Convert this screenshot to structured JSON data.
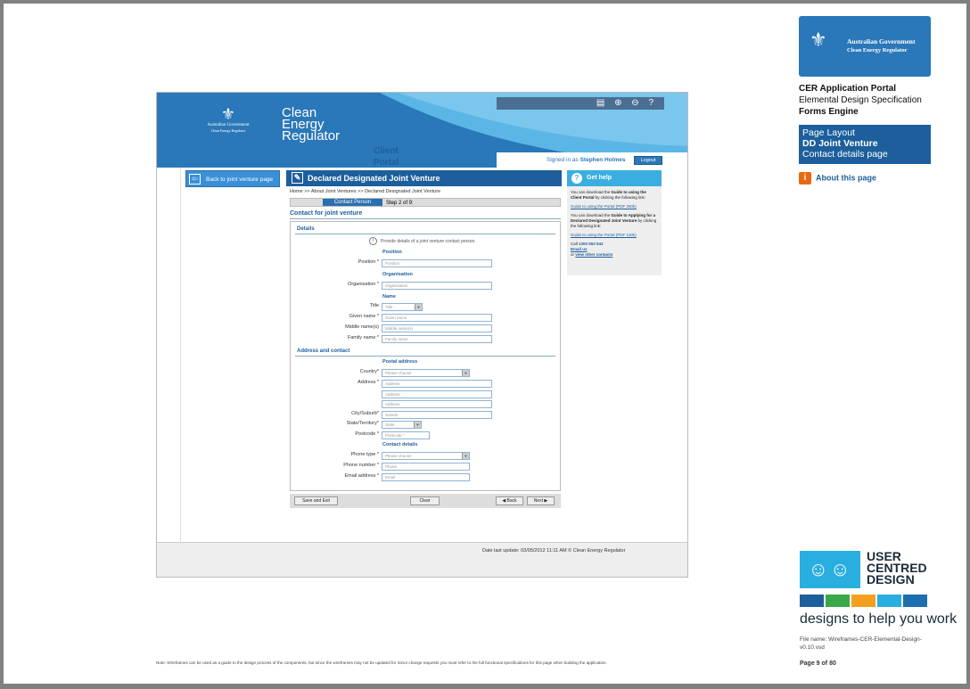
{
  "portal": {
    "gov_logo": {
      "line1": "Australian Government",
      "line2": "Clean Energy Regulator"
    },
    "brand": {
      "line1": "Clean",
      "line2": "Energy",
      "line3": "Regulator",
      "sub": "Client Portal"
    },
    "signed_in_prefix": "Signed in as",
    "user_name": "Stephen Holmes",
    "logout_label": "Logout",
    "back_label": "Back to joint venture page",
    "main_title": "Declared Designated Joint Venture",
    "breadcrumb": "Home >> About Joint Ventures >> Declared Designated Joint Venture",
    "step_current": "Contact Person",
    "step_text": "Step 2 of 9:",
    "section_title": "Contact for joint venture",
    "details_heading": "Details",
    "info_text": "Provide details of a joint venture contact person.",
    "position": {
      "sub": "Position",
      "label": "Position *",
      "placeholder": "Position"
    },
    "organisation": {
      "sub": "Organisation",
      "label": "Organisation *",
      "placeholder": "Organisation"
    },
    "name": {
      "sub": "Name",
      "title_label": "Title",
      "title_placeholder": "Title",
      "given_label": "Given name *",
      "given_placeholder": "Given name",
      "middle_label": "Middle name(s)",
      "middle_placeholder": "Middle name(s)",
      "family_label": "Family name *",
      "family_placeholder": "Family name"
    },
    "address_heading": "Address and contact",
    "postal": {
      "sub": "Postal address",
      "country_label": "Country*",
      "country_placeholder": "Please choose",
      "address_label": "Address *",
      "address_placeholder": "Address",
      "city_label": "City/Suburb*",
      "city_placeholder": "Suburb",
      "state_label": "State/Territory*",
      "state_placeholder": "State",
      "postcode_label": "Postcode *",
      "postcode_placeholder": "Postcode *"
    },
    "contact": {
      "sub": "Contact details",
      "phone_type_label": "Phone type *",
      "phone_type_placeholder": "Please choose",
      "phone_label": "Phone number *",
      "phone_placeholder": "Phone",
      "email_label": "Email address *",
      "email_placeholder": "Email"
    },
    "buttons": {
      "save_exit": "Save and Exit",
      "clear": "Clear",
      "back": "◀ Back",
      "next": "Next ▶"
    },
    "help": {
      "title": "Get help",
      "p1_pre": "You can download the",
      "p1_bold": "Guide to using the Client Portal",
      "p1_post": "by clicking the following link:",
      "p1_link": "Guide to using the Portal (PDF 260k)",
      "p2_pre": "You can download the",
      "p2_bold": "Guide to Applying for a Declared Designated Joint Venture",
      "p2_post": "by clicking the following link:",
      "p2_link": "Guide to using the Portal (PDF 120k)",
      "call": "Call",
      "phone": "1300 553 542",
      "email_link": "Email us",
      "or": "or",
      "other_link": "view other contacts"
    },
    "footer": "Date last update: 03/05/2012 11:11 AM   © Clean Energy Regulator"
  },
  "side": {
    "logo_line1": "Australian Government",
    "logo_line2": "Clean Energy Regulator",
    "portal_title": "CER Application Portal",
    "spec": "Elemental Design Specification",
    "engine": "Forms Engine",
    "page_layout": "Page Layout",
    "dd_joint": "DD Joint Venture",
    "contact_page": "Contact details page",
    "about": "About this page",
    "ucd_line1": "USER",
    "ucd_line2": "CENTRED",
    "ucd_line3": "DESIGN",
    "tagline": "designs to help you work",
    "file_name": "File name: Wireframes-CER-Elemental-Design-v0.10.vsd",
    "page": "Page 9 of 80"
  },
  "note": "Note: Wireframes can be used as a guide to the design process of the components, but since the wireframes may not be updated for minor change requests you must refer to the full functional specifications for this page when building the application.",
  "colors": {
    "brand_blue": "#2a77b9",
    "dark_blue": "#1d5f9c",
    "help_blue": "#3aaee0",
    "about_orange": "#e86a10"
  },
  "ucd_bar_colors": [
    "#1d5f9c",
    "#3aa84a",
    "#f3a020",
    "#29aee0",
    "#1d6fb0"
  ]
}
